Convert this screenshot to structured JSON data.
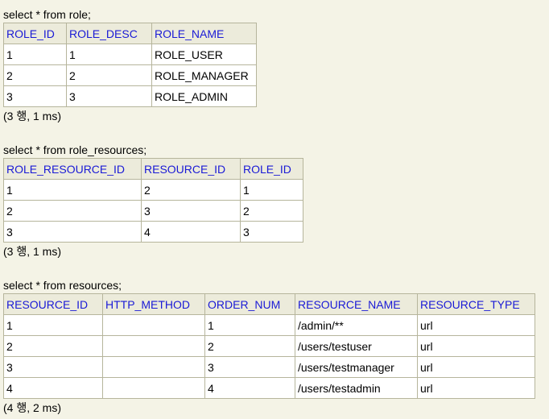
{
  "queries": [
    {
      "sql": "select * from role;",
      "columns": [
        "ROLE_ID",
        "ROLE_DESC",
        "ROLE_NAME"
      ],
      "rows": [
        [
          "1",
          "1",
          "ROLE_USER"
        ],
        [
          "2",
          "2",
          "ROLE_MANAGER"
        ],
        [
          "3",
          "3",
          "ROLE_ADMIN"
        ]
      ],
      "status": "(3 행, 1 ms)"
    },
    {
      "sql": "select * from role_resources;",
      "columns": [
        "ROLE_RESOURCE_ID",
        "RESOURCE_ID",
        "ROLE_ID"
      ],
      "rows": [
        [
          "1",
          "2",
          "1"
        ],
        [
          "2",
          "3",
          "2"
        ],
        [
          "3",
          "4",
          "3"
        ]
      ],
      "status": "(3 행, 1 ms)"
    },
    {
      "sql": "select * from resources;",
      "columns": [
        "RESOURCE_ID",
        "HTTP_METHOD",
        "ORDER_NUM",
        "RESOURCE_NAME",
        "RESOURCE_TYPE"
      ],
      "rows": [
        [
          "1",
          "",
          "1",
          "/admin/**",
          "url"
        ],
        [
          "2",
          "",
          "2",
          "/users/testuser",
          "url"
        ],
        [
          "3",
          "",
          "3",
          "/users/testmanager",
          "url"
        ],
        [
          "4",
          "",
          "4",
          "/users/testadmin",
          "url"
        ]
      ],
      "status": "(4 행, 2 ms)"
    }
  ]
}
